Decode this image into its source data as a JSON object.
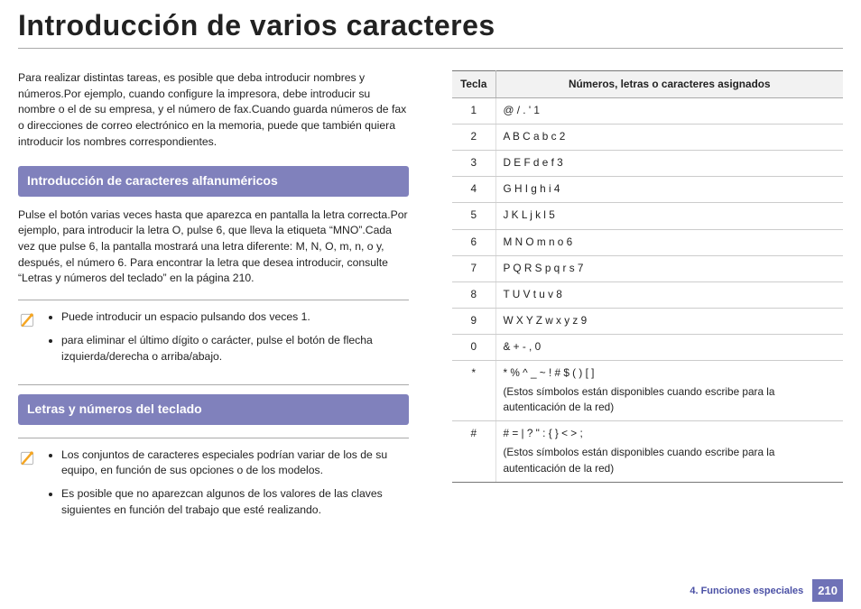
{
  "title": "Introducción de varios caracteres",
  "left": {
    "intro": "Para realizar distintas tareas, es posible que deba introducir nombres y números.Por ejemplo, cuando configure la impresora, debe introducir su nombre o el de su empresa, y el número de fax.Cuando guarda números de fax o direcciones de correo electrónico en la memoria, puede que también quiera introducir los nombres correspondientes.",
    "section1_head": "Introducción de caracteres alfanuméricos",
    "section1_body": "Pulse el botón varias veces hasta que aparezca en pantalla la letra correcta.Por ejemplo, para introducir la letra O, pulse 6, que lleva la etiqueta “MNO”.Cada vez que pulse 6, la pantalla mostrará una letra diferente: M, N, O, m, n, o y, después, el número 6. Para encontrar la letra que desea introducir, consulte “Letras y números del teclado” en la página 210.",
    "note1": {
      "items": [
        "Puede introducir un espacio pulsando dos veces 1.",
        "para eliminar el último dígito o carácter, pulse el botón de flecha izquierda/derecha o arriba/abajo."
      ]
    },
    "section2_head": "Letras y números del teclado",
    "note2": {
      "items": [
        "Los conjuntos de caracteres especiales podrían variar de los de su equipo, en función de sus opciones o de los modelos.",
        "Es posible que no aparezcan algunos de los valores de las claves siguientes en función del trabajo que esté realizando."
      ]
    }
  },
  "table": {
    "head_key": "Tecla",
    "head_val": "Números, letras o caracteres asignados",
    "rows": [
      {
        "k": "1",
        "v": "@ / . ' 1"
      },
      {
        "k": "2",
        "v": "A B C a b c 2"
      },
      {
        "k": "3",
        "v": "D E F d e f 3"
      },
      {
        "k": "4",
        "v": "G H I g h i 4"
      },
      {
        "k": "5",
        "v": "J K L j k l 5"
      },
      {
        "k": "6",
        "v": "M N O m n o 6"
      },
      {
        "k": "7",
        "v": "P Q R S p q r s 7"
      },
      {
        "k": "8",
        "v": "T U V t u v 8"
      },
      {
        "k": "9",
        "v": "W X Y Z w x y z 9"
      },
      {
        "k": "0",
        "v": "& + - , 0"
      },
      {
        "k": "*",
        "v": "* % ^ _ ~ ! # $ ( ) [ ]",
        "extra": "(Estos símbolos están disponibles cuando escribe para la autenticación de la red)"
      },
      {
        "k": "#",
        "v": "# = | ? \" : { } < > ;",
        "extra": "(Estos símbolos están disponibles cuando escribe para la autenticación de la red)"
      }
    ]
  },
  "footer": {
    "chapter": "4.  Funciones especiales",
    "page": "210"
  }
}
